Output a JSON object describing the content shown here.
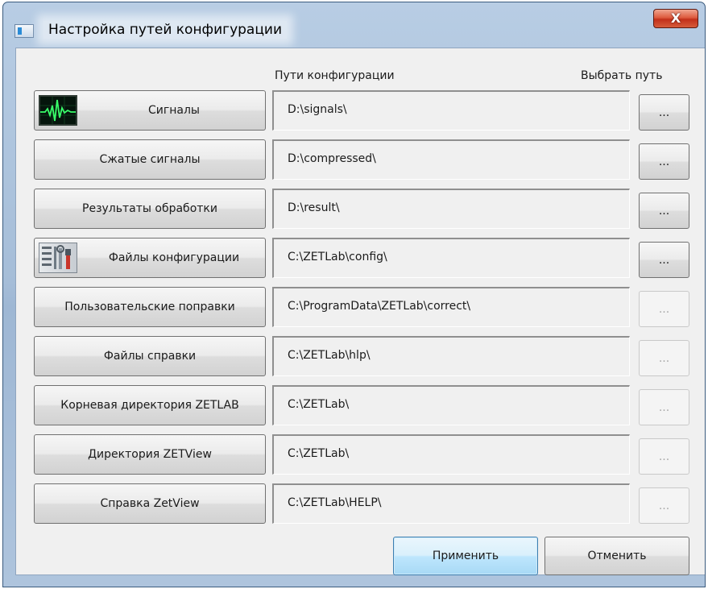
{
  "window": {
    "title": "Настройка путей конфигурации",
    "close_label": "X"
  },
  "columns": {
    "paths_header": "Пути конфигурации",
    "browse_header": "Выбрать путь"
  },
  "rows": [
    {
      "label": "Сигналы",
      "path": "D:\\signals\\",
      "browse": "...",
      "icon": "waveform-icon",
      "browse_enabled": true
    },
    {
      "label": "Сжатые сигналы",
      "path": "D:\\compressed\\",
      "browse": "...",
      "browse_enabled": true
    },
    {
      "label": "Результаты обработки",
      "path": "D:\\result\\",
      "browse": "...",
      "browse_enabled": true
    },
    {
      "label": "Файлы конфигурации",
      "path": "C:\\ZETLab\\config\\",
      "browse": "...",
      "icon": "config-tools-icon",
      "browse_enabled": true
    },
    {
      "label": "Пользовательские поправки",
      "path": "C:\\ProgramData\\ZETLab\\correct\\",
      "browse": "...",
      "browse_enabled": false
    },
    {
      "label": "Файлы справки",
      "path": "C:\\ZETLab\\hlp\\",
      "browse": "...",
      "browse_enabled": false
    },
    {
      "label": "Корневая директория ZETLAB",
      "path": "C:\\ZETLab\\",
      "browse": "...",
      "browse_enabled": false
    },
    {
      "label": "Директория ZETView",
      "path": "C:\\ZETLab\\",
      "browse": "...",
      "browse_enabled": false
    },
    {
      "label": "Справка ZetView",
      "path": "C:\\ZETLab\\HELP\\",
      "browse": "...",
      "browse_enabled": false
    }
  ],
  "footer": {
    "apply_label": "Применить",
    "cancel_label": "Отменить"
  },
  "colors": {
    "frame": "#a5bdd8",
    "client_bg": "#f0f0f0",
    "close_red": "#c2301a",
    "apply_highlight": "#bee6fd"
  }
}
